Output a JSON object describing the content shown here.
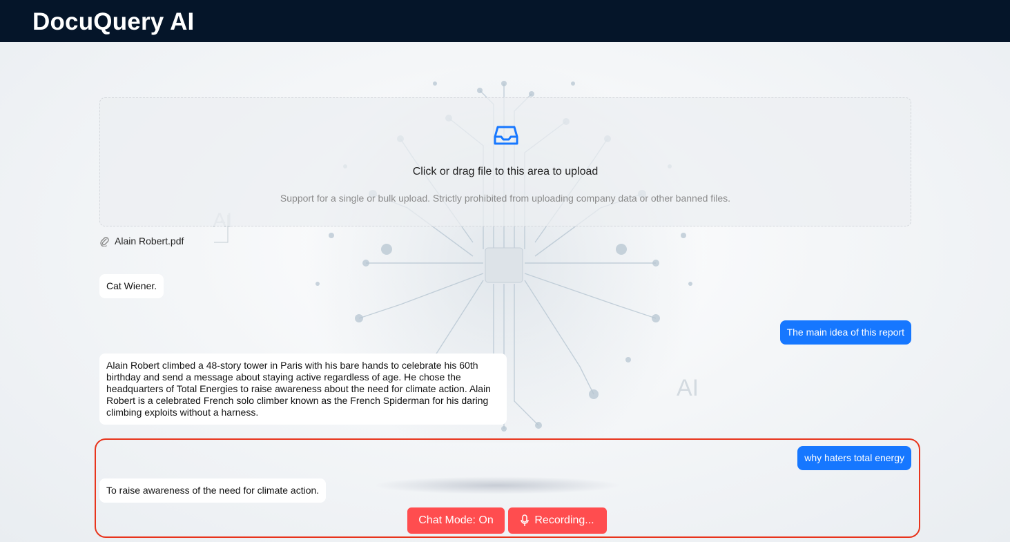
{
  "header": {
    "title": "DocuQuery AI"
  },
  "upload": {
    "icon": "inbox-icon",
    "text": "Click or drag file to this area to upload",
    "hint": "Support for a single or bulk upload. Strictly prohibited from uploading company data or other banned files."
  },
  "files": [
    {
      "icon": "paperclip-icon",
      "name": "Alain Robert.pdf"
    }
  ],
  "messages": [
    {
      "role": "bot",
      "text": "Cat Wiener."
    },
    {
      "role": "user",
      "text": "The main idea of this report"
    },
    {
      "role": "bot",
      "text": "Alain Robert climbed a 48-story tower in Paris with his bare hands to celebrate his 60th birthday and send a message about staying active regardless of age. He chose the headquarters of Total Energies to raise awareness about the need for climate action. Alain Robert is a celebrated French solo climber known as the French Spiderman for his daring climbing exploits without a harness."
    },
    {
      "role": "user",
      "text": "why haters total energy"
    },
    {
      "role": "bot",
      "text": "To raise awareness of the need for climate action."
    }
  ],
  "controls": {
    "chat_mode_label": "Chat Mode: On",
    "recording_label": "Recording...",
    "recording_icon": "microphone-icon"
  },
  "background_watermarks": [
    "AI",
    "AI"
  ],
  "colors": {
    "header_bg": "#051529",
    "primary": "#1677ff",
    "danger": "#ff4d4f",
    "highlight_border": "#e8341c"
  }
}
